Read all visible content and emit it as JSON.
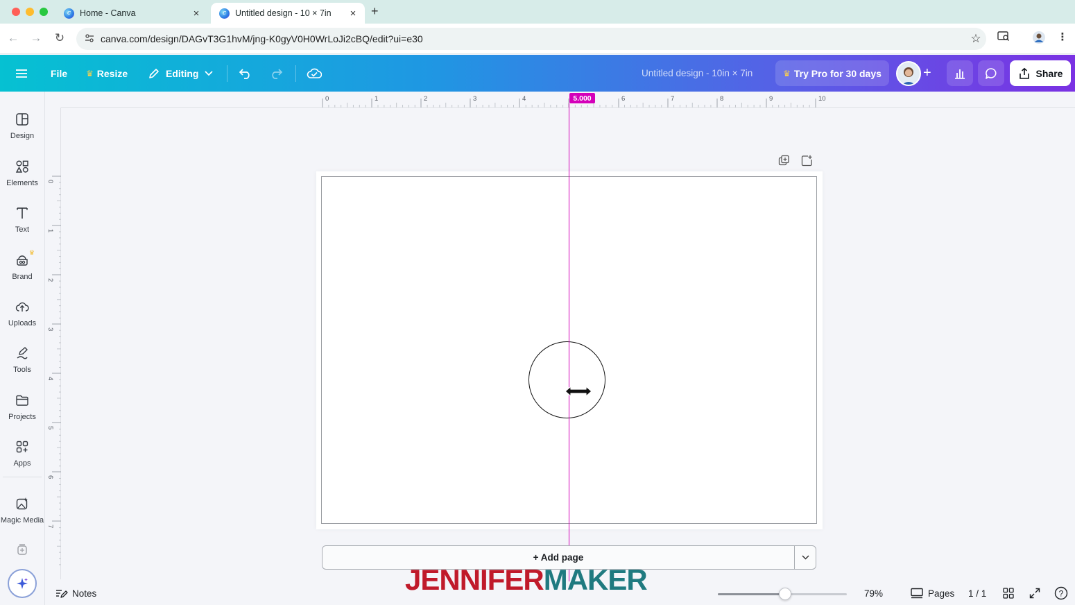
{
  "browser": {
    "tabs": [
      {
        "label": "Home - Canva",
        "active": false
      },
      {
        "label": "Untitled design - 10 × 7in",
        "active": true
      }
    ],
    "url": "canva.com/design/DAGvT3G1hvM/jng-K0gyV0H0WrLoJi2cBQ/edit?ui=e30"
  },
  "header": {
    "file_label": "File",
    "resize_label": "Resize",
    "editing_label": "Editing",
    "design_title": "Untitled design - 10in × 7in",
    "pro_label": "Try Pro for 30 days",
    "share_label": "Share"
  },
  "sidebar": {
    "items": [
      {
        "label": "Design",
        "icon": "layout-icon"
      },
      {
        "label": "Elements",
        "icon": "shapes-icon"
      },
      {
        "label": "Text",
        "icon": "text-icon"
      },
      {
        "label": "Brand",
        "icon": "brand-icon"
      },
      {
        "label": "Uploads",
        "icon": "cloud-upload-icon"
      },
      {
        "label": "Tools",
        "icon": "pen-tool-icon"
      },
      {
        "label": "Projects",
        "icon": "folder-icon"
      },
      {
        "label": "Apps",
        "icon": "apps-icon"
      },
      {
        "label": "Magic Media",
        "icon": "magic-media-icon"
      }
    ]
  },
  "ruler": {
    "top_ticks": [
      "0",
      "1",
      "2",
      "3",
      "4",
      "6",
      "7",
      "8",
      "9",
      "10"
    ],
    "left_ticks": [
      "0",
      "1",
      "2",
      "3",
      "4",
      "5",
      "6",
      "7"
    ],
    "guide_value": "5.000"
  },
  "canvas": {
    "add_page_label": "+ Add page"
  },
  "footer": {
    "notes_label": "Notes",
    "zoom_value": 0.52,
    "zoom_label": "79%",
    "pages_label": "Pages",
    "page_counter": "1 / 1"
  },
  "watermark": {
    "part1": "JENNIFER",
    "part2": "MAKER"
  },
  "colors": {
    "guide": "#d400b9",
    "watermark_red": "#c01a2a",
    "watermark_teal": "#1f7a80"
  }
}
